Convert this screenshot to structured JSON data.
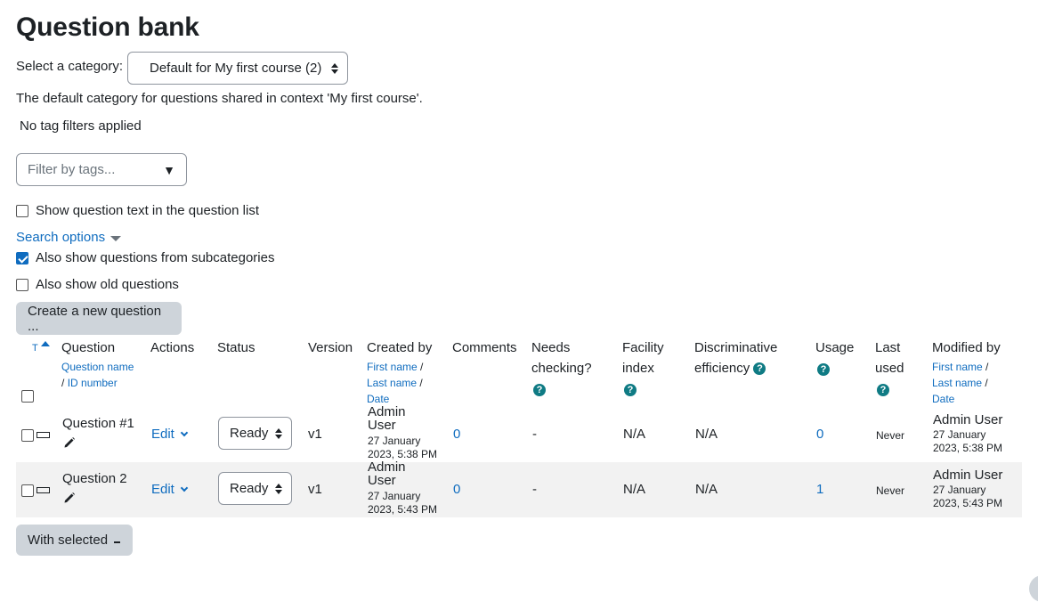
{
  "page": {
    "title": "Question bank"
  },
  "category": {
    "label": "Select a category:",
    "selected": "Default for My first course (2)",
    "description": "The default category for questions shared in context 'My first course'."
  },
  "tags": {
    "status_text": "No tag filters applied",
    "filter_placeholder": "Filter by tags..."
  },
  "options": {
    "show_question_text": "Show question text in the question list",
    "search_options": "Search options",
    "subcategories": "Also show questions from subcategories",
    "old_questions": "Also show old questions"
  },
  "buttons": {
    "create_new": "Create a new question ...",
    "with_selected": "With selected"
  },
  "table": {
    "headers": {
      "type": "T",
      "question": "Question",
      "question_name": "Question name",
      "id_number": "ID number",
      "actions": "Actions",
      "status": "Status",
      "version": "Version",
      "created_by": "Created by",
      "first_name": "First name",
      "last_name": "Last name",
      "date": "Date",
      "comments": "Comments",
      "needs_checking_1": "Needs",
      "needs_checking_2": "checking?",
      "facility_1": "Facility",
      "facility_2": "index",
      "discriminative_1": "Discriminative",
      "discriminative_2": "efficiency",
      "usage": "Usage",
      "last_used_1": "Last",
      "last_used_2": "used",
      "modified_by": "Modified by",
      "slash": "/"
    },
    "rows": [
      {
        "name": "Question #1",
        "action": "Edit",
        "status": "Ready",
        "version": "v1",
        "created_name_1": "Admin",
        "created_name_2": "User",
        "created_date_1": "27 January",
        "created_date_2": "2023, 5:38 PM",
        "comments": "0",
        "needs_checking": "-",
        "facility": "N/A",
        "discriminative": "N/A",
        "usage": "0",
        "last_used": "Never",
        "modified_name": "Admin User",
        "modified_date_1": "27 January",
        "modified_date_2": "2023, 5:38 PM"
      },
      {
        "name": "Question 2",
        "action": "Edit",
        "status": "Ready",
        "version": "v1",
        "created_name_1": "Admin",
        "created_name_2": "User",
        "created_date_1": "27 January",
        "created_date_2": "2023, 5:43 PM",
        "comments": "0",
        "needs_checking": "-",
        "facility": "N/A",
        "discriminative": "N/A",
        "usage": "1",
        "last_used": "Never",
        "modified_name": "Admin User",
        "modified_date_1": "27 January",
        "modified_date_2": "2023, 5:43 PM"
      }
    ]
  },
  "colors": {
    "link": "#0f6cbf",
    "help": "#0f7b84",
    "button": "#ced4da",
    "row_alt": "#f2f2f2"
  }
}
